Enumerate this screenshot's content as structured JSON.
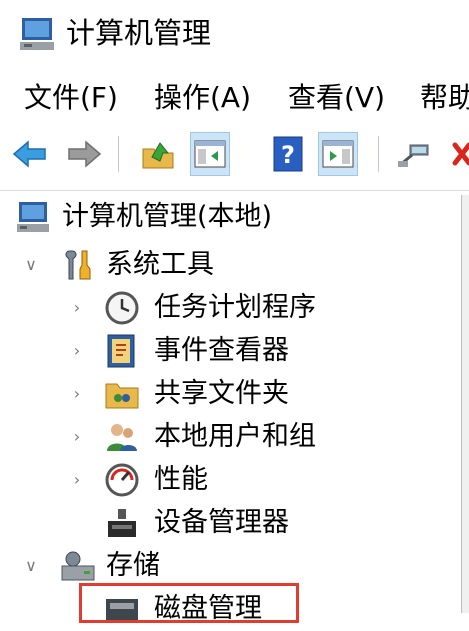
{
  "window": {
    "title": "计算机管理"
  },
  "menu": {
    "file": "文件(F)",
    "action": "操作(A)",
    "view": "查看(V)",
    "help": "帮助"
  },
  "tree": {
    "root": "计算机管理(本地)",
    "system_tools": "系统工具",
    "task_scheduler": "任务计划程序",
    "event_viewer": "事件查看器",
    "shared_folders": "共享文件夹",
    "local_users": "本地用户和组",
    "performance": "性能",
    "device_manager": "设备管理器",
    "storage": "存储",
    "disk_management": "磁盘管理"
  },
  "colors": {
    "highlight": "#e23b30",
    "toolbar_active": "#cce4f7",
    "help_blue": "#2a5fc2"
  }
}
